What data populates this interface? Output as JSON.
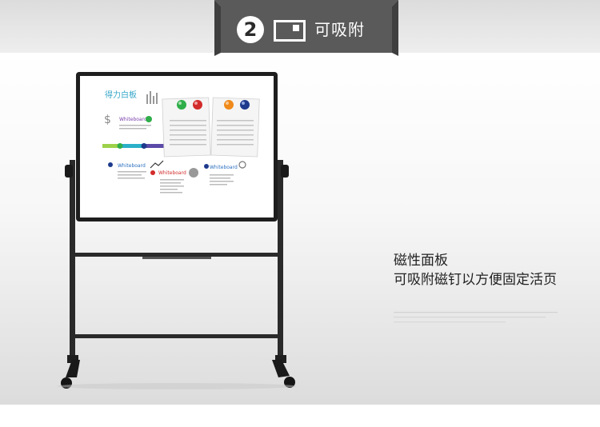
{
  "header": {
    "step_number": "2",
    "icon": "magnet-board-icon",
    "title": "可吸附"
  },
  "product": {
    "board_logo_text": "得力白板",
    "card_label": "Whiteboard",
    "magnet_colors": [
      "#2fae4a",
      "#d22b2b",
      "#f08a1a",
      "#1d3a8c",
      "#333333"
    ],
    "board_frame_color": "#1e1e1e"
  },
  "feature": {
    "heading": "磁性面板",
    "description": "可吸附磁钉以方便固定活页"
  }
}
